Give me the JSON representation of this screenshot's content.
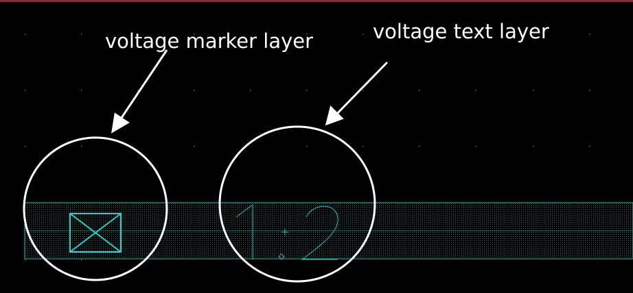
{
  "annotations": {
    "marker_label": "voltage marker layer",
    "text_label": "voltage text layer"
  },
  "layout_view": {
    "voltage_text": "1.2"
  },
  "colors": {
    "background": "#000000",
    "grid_dot": "#6a6a6a",
    "metal_fill": "#1f4a4a",
    "metal_outline": "#2fb8a8",
    "marker": "#22d3d3",
    "voltage_text": "#22c3c3",
    "annotation": "#ffffff",
    "top_bar": "#8b2a3a"
  }
}
